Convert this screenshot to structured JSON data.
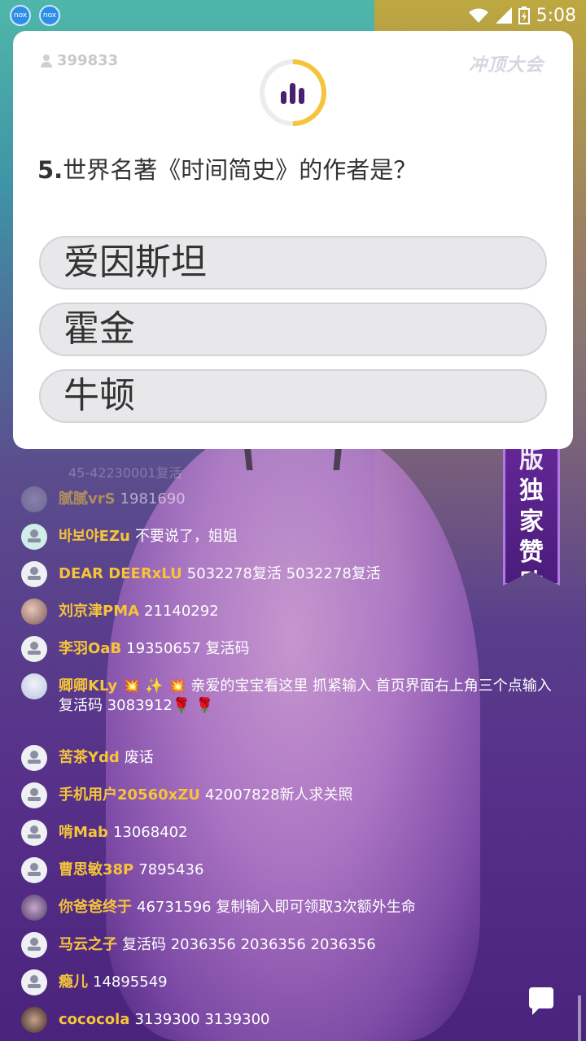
{
  "status_bar": {
    "time": "5:08",
    "app_icon_label": "nox"
  },
  "card": {
    "viewer_count": "399833",
    "logo_text": "冲顶大会",
    "question_number": "5.",
    "question_text": "世界名著《时间简史》的作者是？",
    "options": [
      "爱因斯坦",
      "霍金",
      "牛顿"
    ],
    "timer_color": "#f5c43a",
    "timer_icon_color": "#4a1f6e"
  },
  "sponsor": {
    "chars": [
      "版",
      "独",
      "家",
      "赞",
      "助"
    ]
  },
  "faded_line": "45-42230001复活",
  "chat": [
    {
      "name": "腻腻vrS",
      "text": "1981690"
    },
    {
      "name": "바보야EZu",
      "text": "不要说了，姐姐"
    },
    {
      "name": "DEAR DEERxLU",
      "text": "5032278复活 5032278复活"
    },
    {
      "name": "刘京津PMA",
      "text": "21140292"
    },
    {
      "name": "李羽OaB",
      "text": "19350657 复活码"
    },
    {
      "name": "卿卿KLy",
      "text": "💥 ✨ 💥 亲爱的宝宝看这里 抓紧输入 首页界面右上角三个点输入复活码 3083912🌹 🌹"
    },
    {
      "name": "苦茶Ydd",
      "text": "废话"
    },
    {
      "name": "手机用户20560xZU",
      "text": "42007828新人求关照"
    },
    {
      "name": "啃Mab",
      "text": "13068402"
    },
    {
      "name": "曹思敏38P",
      "text": "7895436"
    },
    {
      "name": "你爸爸终于",
      "text": "46731596  复制输入即可领取3次额外生命"
    },
    {
      "name": "马云之子",
      "text": "复活码 2036356  2036356  2036356"
    },
    {
      "name": "瘾儿",
      "text": "14895549"
    },
    {
      "name": "cococola",
      "text": "3139300 3139300"
    }
  ]
}
